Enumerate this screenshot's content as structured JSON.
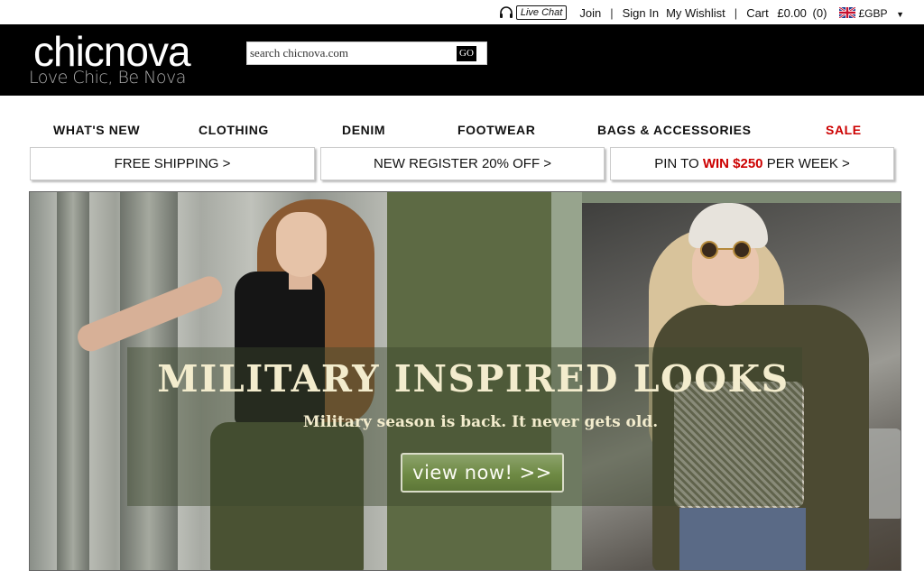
{
  "topbar": {
    "live_chat": "Live Chat",
    "join": "Join",
    "sep1": "|",
    "sign_in": "Sign In",
    "wishlist": "My Wishlist",
    "sep2": "|",
    "cart_label": "Cart",
    "cart_total": "£0.00",
    "cart_count": "(0)",
    "currency": "£GBP",
    "caret": "▼"
  },
  "header": {
    "logo_main": "chicnova",
    "logo_tagline": "Love Chic, Be Nova",
    "search_placeholder": "search chicnova.com",
    "search_button": "GO"
  },
  "nav": {
    "items": [
      {
        "label": "WHAT'S NEW"
      },
      {
        "label": "CLOTHING"
      },
      {
        "label": "DENIM"
      },
      {
        "label": "FOOTWEAR"
      },
      {
        "label": "BAGS & ACCESSORIES"
      },
      {
        "label": "SALE"
      }
    ]
  },
  "promos": {
    "shipping": "FREE SHIPPING   >",
    "register": "NEW REGISTER 20% OFF  >",
    "pin_prefix": "PIN TO ",
    "pin_highlight": "WIN $250",
    "pin_suffix": " PER WEEK  >"
  },
  "hero": {
    "title": "MILITARY INSPIRED LOOKS",
    "subtitle": "Military season is back. It never gets old.",
    "cta": "view now! >>"
  },
  "colors": {
    "accent_red": "#cc0000",
    "header_bg": "#000000",
    "hero_olive": "#5d6a44"
  }
}
